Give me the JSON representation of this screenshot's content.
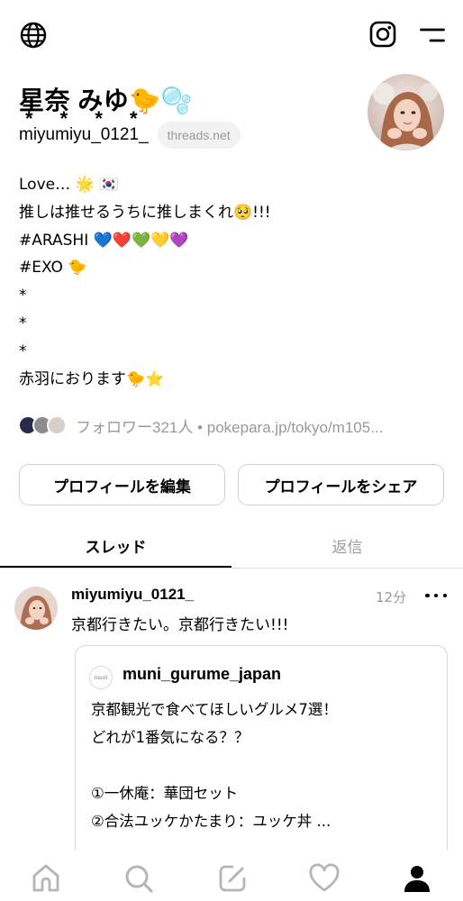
{
  "profile": {
    "display_name": "星奈 みゆ🐤🫧",
    "name_stars": "* * * *",
    "username": "miyumiyu_0121_",
    "domain_pill": "threads.net",
    "bio_lines": [
      "Love… 🌟 🇰🇷",
      "推しは推せるうちに推しまくれ🥺!!!",
      "#ARASHI 💙❤️💚💛💜",
      "#EXO 🐤",
      "*",
      "*",
      "*",
      "赤羽におります🐤⭐"
    ],
    "followers_text": "フォロワー321人 • pokepara.jp/tokyo/m105..."
  },
  "buttons": {
    "edit_profile": "プロフィールを編集",
    "share_profile": "プロフィールをシェア"
  },
  "tabs": {
    "threads": "スレッド",
    "replies": "返信"
  },
  "post": {
    "username": "miyumiyu_0121_",
    "time": "12分",
    "text": "京都行きたい。京都行きたい!!!",
    "quote": {
      "logo_text": "muni",
      "username": "muni_gurume_japan",
      "lines": [
        "京都観光で食べてほしいグルメ7選！",
        "どれが1番気になる？？",
        "",
        "①一休庵：華団セット",
        "②合法ユッケかたまり：ユッケ丼 ..."
      ]
    }
  },
  "icons": {
    "globe": "globe-icon",
    "instagram": "instagram-icon",
    "menu": "menu-icon",
    "home": "home-icon",
    "search": "search-icon",
    "compose": "compose-icon",
    "activity": "heart-icon",
    "profile": "profile-icon"
  },
  "colors": {
    "muted": "#999999",
    "border": "#d0d0d0",
    "pill_bg": "#f2f2f2"
  }
}
